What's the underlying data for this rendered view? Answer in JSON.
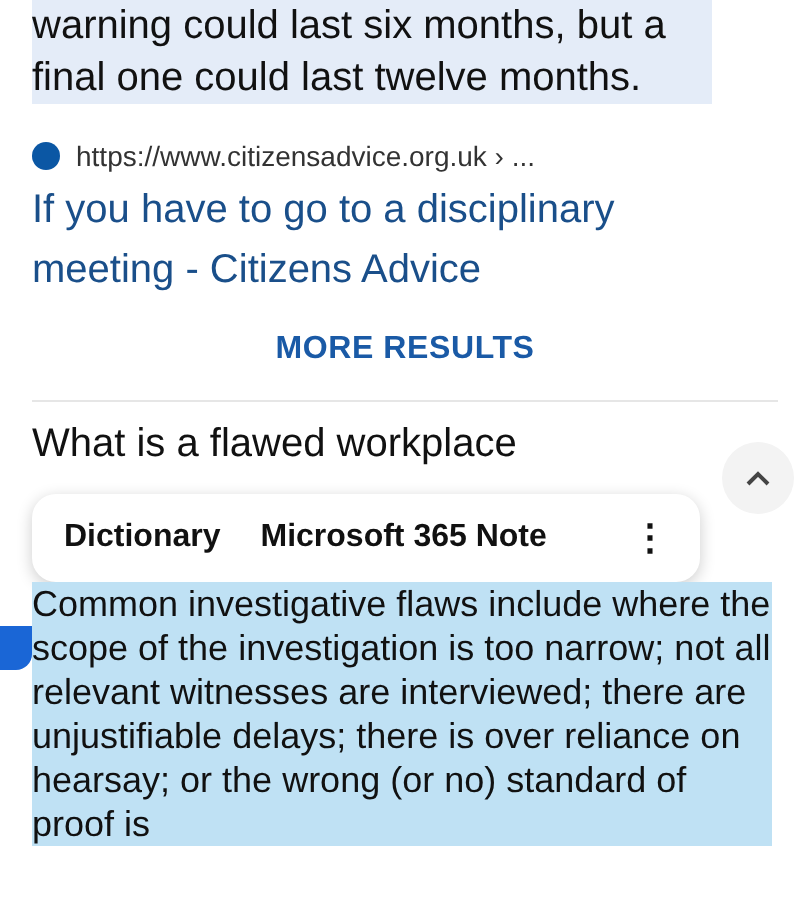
{
  "snippet": {
    "text": "warning could last six months, but a final one could last twelve months."
  },
  "source": {
    "url": "https://www.citizensadvice.org.uk › ...",
    "title": "If you have to go to a disciplinary meeting - Citizens Advice"
  },
  "more_results": "MORE RESULTS",
  "question": {
    "title": "What is a flawed workplace",
    "expanded": true
  },
  "selection_menu": {
    "items": [
      "Dictionary",
      "Microsoft 365 Note"
    ],
    "more": "⋮"
  },
  "answer": {
    "text": "Common investigative flaws include where the scope of the investigation is too narrow; not all relevant witnesses are interviewed; there are unjustifiable delays; there is over reliance on hearsay; or the wrong (or no) standard of proof is"
  }
}
